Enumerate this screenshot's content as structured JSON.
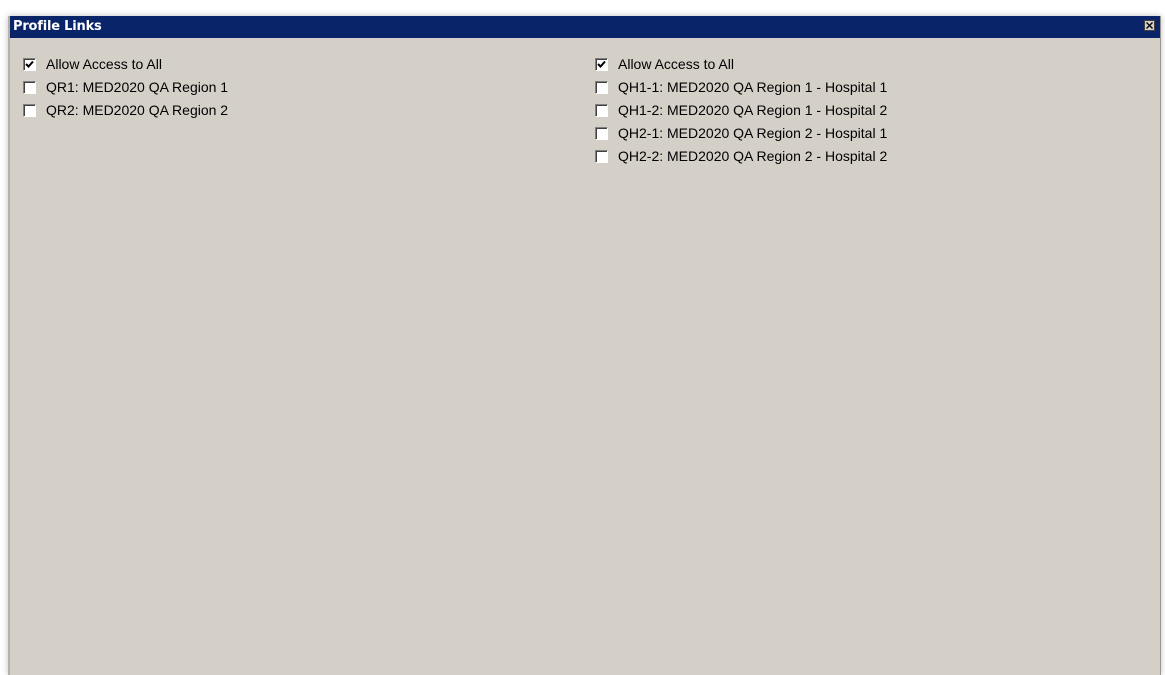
{
  "window": {
    "title": "Profile Links"
  },
  "left_column": {
    "items": [
      {
        "label": "Allow Access to All",
        "checked": true
      },
      {
        "label": "QR1: MED2020 QA Region 1",
        "checked": false
      },
      {
        "label": "QR2: MED2020 QA Region 2",
        "checked": false
      }
    ]
  },
  "right_column": {
    "items": [
      {
        "label": "Allow Access to All",
        "checked": true
      },
      {
        "label": "QH1-1: MED2020 QA Region 1 - Hospital 1",
        "checked": false
      },
      {
        "label": "QH1-2: MED2020 QA Region 1 - Hospital 2",
        "checked": false
      },
      {
        "label": "QH2-1: MED2020 QA Region 2 - Hospital 1",
        "checked": false
      },
      {
        "label": "QH2-2: MED2020 QA Region 2 - Hospital 2",
        "checked": false
      }
    ]
  },
  "colors": {
    "titlebar": "#0a246a",
    "panel": "#d4d0c8"
  }
}
